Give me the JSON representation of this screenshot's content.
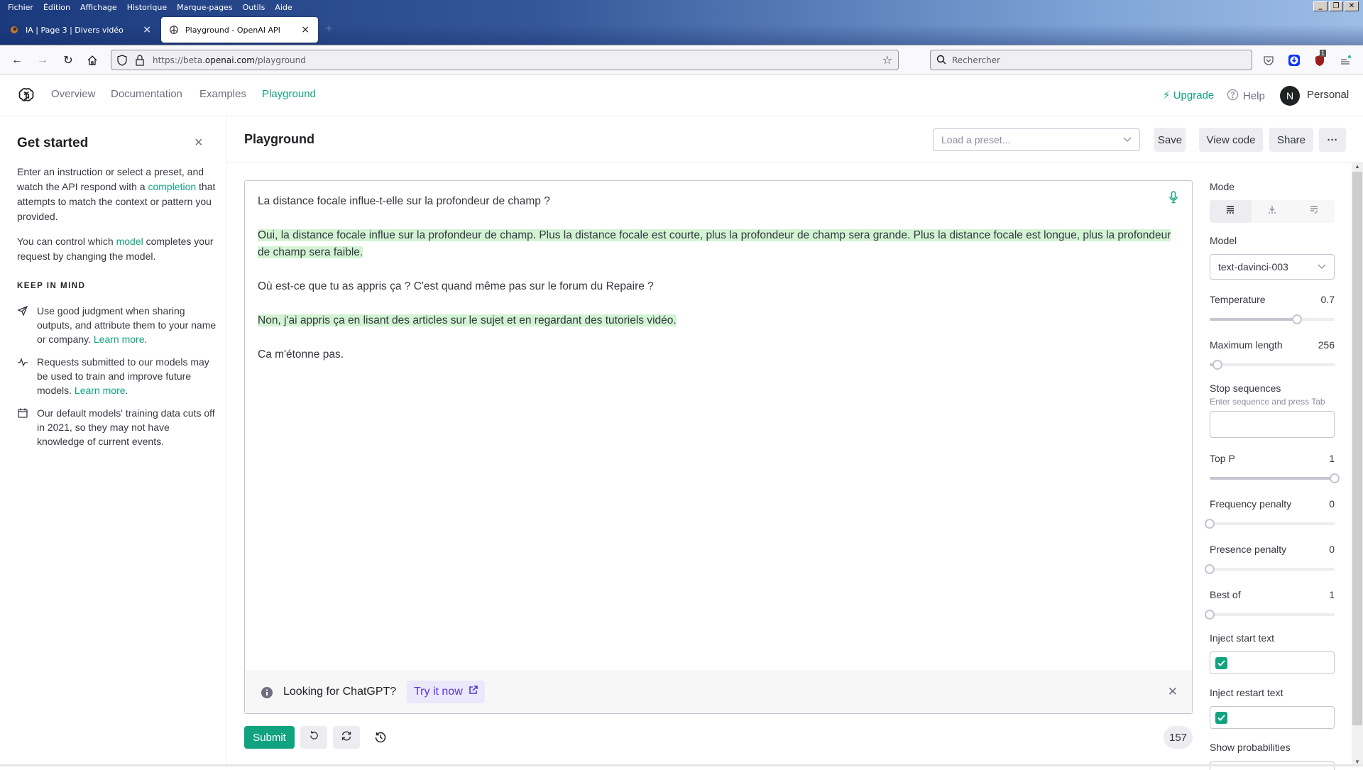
{
  "browser": {
    "menu": [
      "Fichier",
      "Édition",
      "Affichage",
      "Historique",
      "Marque-pages",
      "Outils",
      "Aide"
    ],
    "tabs": [
      {
        "title": "IA | Page 3 | Divers vidéo",
        "active": false
      },
      {
        "title": "Playground - OpenAI API",
        "active": true
      }
    ],
    "url_prefix": "https://beta.",
    "url_domain": "openai.com",
    "url_path": "/playground",
    "search_placeholder": "Rechercher",
    "extension_badge": "1"
  },
  "header": {
    "nav": [
      "Overview",
      "Documentation",
      "Examples",
      "Playground"
    ],
    "active_nav": "Playground",
    "upgrade": "Upgrade",
    "help": "Help",
    "avatar_initial": "N",
    "account": "Personal"
  },
  "sidebar": {
    "title": "Get started",
    "intro_1_a": "Enter an instruction or select a preset, and watch the API respond with a ",
    "intro_1_link": "completion",
    "intro_1_b": " that attempts to match the context or pattern you provided.",
    "intro_2_a": "You can control which ",
    "intro_2_link": "model",
    "intro_2_b": " completes your request by changing the model.",
    "keep_in_mind": "KEEP IN MIND",
    "items": [
      {
        "icon": "send-icon",
        "text": "Use good judgment when sharing outputs, and attribute them to your name or company. ",
        "link": "Learn more",
        "suffix": "."
      },
      {
        "icon": "activity-icon",
        "text": "Requests submitted to our models may be used to train and improve future models. ",
        "link": "Learn more",
        "suffix": "."
      },
      {
        "icon": "calendar-icon",
        "text": "Our default models' training data cuts off in 2021, so they may not have knowledge of current events.",
        "link": "",
        "suffix": ""
      }
    ]
  },
  "main": {
    "title": "Playground",
    "preset_placeholder": "Load a preset...",
    "buttons": {
      "save": "Save",
      "view_code": "View code",
      "share": "Share",
      "more": "···"
    },
    "editor": {
      "paragraphs": [
        {
          "text": "La distance focale influe-t-elle sur la profondeur de champ ?",
          "generated": false
        },
        {
          "text": "Oui, la distance focale influe sur la profondeur de champ. Plus la distance focale est courte, plus la profondeur de champ sera grande. Plus la distance focale est longue, plus la profondeur de champ sera faible.",
          "generated": true
        },
        {
          "text": "Où est-ce que tu as appris ça ? C'est quand même pas sur le forum du Repaire ?",
          "generated": false
        },
        {
          "text": "Non, j'ai appris ça en lisant des articles sur le sujet et en regardant des tutoriels vidéo.",
          "generated": true
        },
        {
          "text": "Ca m'étonne pas.",
          "generated": false
        }
      ],
      "highlight_color": "#d2f4d3"
    },
    "banner": {
      "text": "Looking for ChatGPT?",
      "link": "Try it now"
    },
    "submit": "Submit",
    "token_count": "157"
  },
  "settings": {
    "mode_label": "Mode",
    "mode_options": [
      "complete",
      "insert",
      "edit"
    ],
    "mode_selected": "complete",
    "model_label": "Model",
    "model_value": "text-davinci-003",
    "temperature": {
      "label": "Temperature",
      "value": "0.7",
      "fraction": 0.7
    },
    "max_length": {
      "label": "Maximum length",
      "value": "256",
      "fraction": 0.06
    },
    "stop_sequences": {
      "label": "Stop sequences",
      "hint": "Enter sequence and press Tab",
      "value": ""
    },
    "top_p": {
      "label": "Top P",
      "value": "1",
      "fraction": 1.0
    },
    "frequency_penalty": {
      "label": "Frequency penalty",
      "value": "0",
      "fraction": 0.0
    },
    "presence_penalty": {
      "label": "Presence penalty",
      "value": "0",
      "fraction": 0.0
    },
    "best_of": {
      "label": "Best of",
      "value": "1",
      "fraction": 0.0
    },
    "inject_start": {
      "label": "Inject start text",
      "checked": true
    },
    "inject_restart": {
      "label": "Inject restart text",
      "checked": true
    },
    "show_probabilities": {
      "label": "Show probabilities"
    }
  },
  "colors": {
    "accent": "#10a37f",
    "link_purple": "#5436da"
  }
}
